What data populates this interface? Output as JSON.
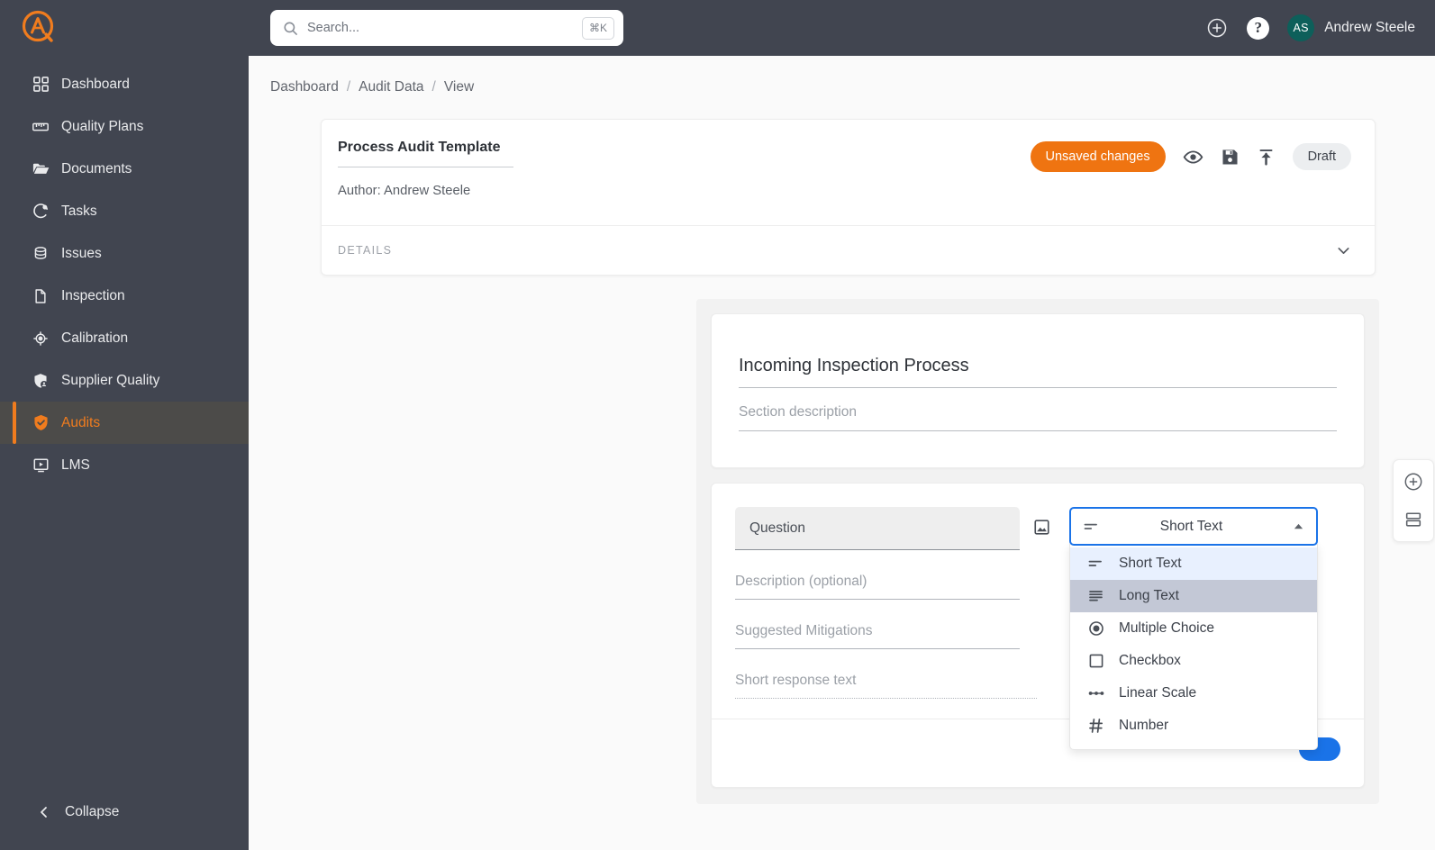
{
  "brand": {
    "accent": "#f07c1e",
    "sidebar_bg": "#414550",
    "blue": "#1a73e8",
    "orange": "#ef7411",
    "avatar_bg": "#0d5f5a"
  },
  "topbar": {
    "search": {
      "placeholder": "Search...",
      "value": "",
      "shortcut": "⌘K",
      "icon": "search-icon"
    },
    "add_icon": "plus-circle-icon",
    "help_icon": "help-icon",
    "help_label": "?",
    "user": {
      "initials": "AS",
      "name": "Andrew Steele"
    }
  },
  "sidebar": {
    "logo_icon": "company-logo-icon",
    "items": [
      {
        "label": "Dashboard",
        "icon": "grid-icon",
        "active": false
      },
      {
        "label": "Quality Plans",
        "icon": "ruler-icon",
        "active": false
      },
      {
        "label": "Documents",
        "icon": "folder-icon",
        "active": false
      },
      {
        "label": "Tasks",
        "icon": "pie-progress-icon",
        "active": false
      },
      {
        "label": "Issues",
        "icon": "database-icon",
        "active": false
      },
      {
        "label": "Inspection",
        "icon": "file-icon",
        "active": false
      },
      {
        "label": "Calibration",
        "icon": "crosshair-icon",
        "active": false
      },
      {
        "label": "Supplier Quality",
        "icon": "shield-user-icon",
        "active": false
      },
      {
        "label": "Audits",
        "icon": "shield-check-icon",
        "active": true
      },
      {
        "label": "LMS",
        "icon": "video-play-icon",
        "active": false
      }
    ],
    "collapse": {
      "label": "Collapse",
      "icon": "chevron-left-icon"
    }
  },
  "breadcrumb": {
    "items": [
      "Dashboard",
      "Audit Data",
      "View"
    ],
    "separator": "/"
  },
  "template_header": {
    "title": "Process Audit Template",
    "author": "Author: Andrew Steele",
    "unsaved_label": "Unsaved changes",
    "preview_icon": "eye-icon",
    "save_icon": "floppy-save-icon",
    "publish_icon": "upload-icon",
    "status_label": "Draft",
    "details_label": "DETAILS",
    "details_chevron_icon": "chevron-down-icon"
  },
  "section": {
    "title": "Incoming Inspection Process",
    "description_placeholder": "Section description"
  },
  "question": {
    "text_placeholder": "Question",
    "description_placeholder": "Description (optional)",
    "mitigations_placeholder": "Suggested Mitigations",
    "response_placeholder": "Short response text",
    "image_icon": "image-icon",
    "type_selected": "Short Text",
    "type_selected_icon": "short-text-icon",
    "chevron_icon": "chevron-up-icon",
    "options": [
      {
        "label": "Short Text",
        "icon": "short-text-icon",
        "state": "selected"
      },
      {
        "label": "Long Text",
        "icon": "long-text-icon",
        "state": "hovered"
      },
      {
        "label": "Multiple Choice",
        "icon": "radio-icon",
        "state": ""
      },
      {
        "label": "Checkbox",
        "icon": "checkbox-icon",
        "state": ""
      },
      {
        "label": "Linear Scale",
        "icon": "linear-scale-icon",
        "state": ""
      },
      {
        "label": "Number",
        "icon": "hash-icon",
        "state": ""
      }
    ],
    "required_toggle_on": true
  },
  "fab": {
    "add_question_icon": "plus-circle-icon",
    "add_section_icon": "add-section-icon"
  }
}
